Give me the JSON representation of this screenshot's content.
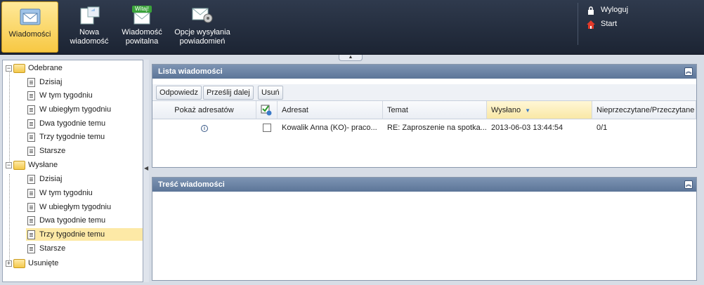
{
  "toolbar": {
    "items": [
      {
        "label": "Wiadomości",
        "icon": "messages-icon",
        "active": true
      },
      {
        "label": "Nowa wiadomość",
        "icon": "new-message-icon"
      },
      {
        "label": "Wiadomość powitalna",
        "icon": "welcome-message-icon",
        "badge": "Witaj!"
      },
      {
        "label": "Opcje wysyłania powiadomień",
        "icon": "notification-settings-icon"
      }
    ],
    "logout_label": "Wyloguj",
    "start_label": "Start"
  },
  "tree": {
    "received": {
      "label": "Odebrane",
      "items": [
        "Dzisiaj",
        "W tym tygodniu",
        "W ubiegłym tygodniu",
        "Dwa tygodnie temu",
        "Trzy tygodnie temu",
        "Starsze"
      ]
    },
    "sent": {
      "label": "Wysłane",
      "items": [
        "Dzisiaj",
        "W tym tygodniu",
        "W ubiegłym tygodniu",
        "Dwa tygodnie temu",
        "Trzy tygodnie temu",
        "Starsze"
      ],
      "selected": "Trzy tygodnie temu"
    },
    "deleted": {
      "label": "Usunięte"
    }
  },
  "message_list": {
    "title": "Lista wiadomości",
    "actions": {
      "reply": "Odpowiedz",
      "forward": "Prześlij dalej",
      "delete": "Usuń"
    },
    "columns": {
      "show_recipients": "Pokaż adresatów",
      "recipient": "Adresat",
      "subject": "Temat",
      "sent": "Wysłano",
      "read_status": "Nieprzeczytane/Przeczytane"
    },
    "rows": [
      {
        "recipient": "Kowalik Anna (KO)- praco...",
        "subject": "RE: Zaproszenie na spotka...",
        "sent": "2013-06-03 13:44:54",
        "read_status": "0/1"
      }
    ]
  },
  "message_content": {
    "title": "Treść wiadomości"
  },
  "colors": {
    "toolbar": "#243044",
    "active": "#f7c843",
    "panel_header": "#6a83a6",
    "selected_row": "#fde9a6"
  }
}
